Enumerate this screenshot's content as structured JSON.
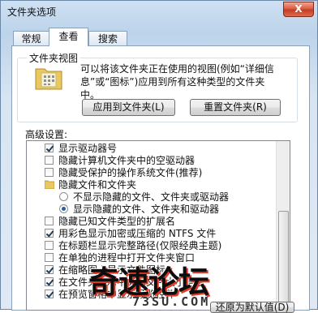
{
  "window": {
    "title": "文件夹选项",
    "close_label": "X"
  },
  "tabs": [
    {
      "label": "常规",
      "active": false
    },
    {
      "label": "查看",
      "active": true
    },
    {
      "label": "搜索",
      "active": false
    }
  ],
  "folder_views": {
    "group_label": "文件夹视图",
    "description_line1": "可以将该文件夹正在使用的视图(例如“详细信",
    "description_line2": "息”或“图标”)应用到所有这种类型的文件夹",
    "description_line3": "中。",
    "apply_button": "应用到文件夹(L)",
    "reset_button": "重置文件夹(R)"
  },
  "advanced": {
    "label": "高级设置:",
    "items": [
      {
        "type": "checkbox",
        "label": "显示驱动器号",
        "checked": true
      },
      {
        "type": "checkbox",
        "label": "隐藏计算机文件夹中的空驱动器",
        "checked": false
      },
      {
        "type": "checkbox",
        "label": "隐藏受保护的操作系统文件(推荐)",
        "checked": false
      },
      {
        "type": "folder",
        "label": "隐藏文件和文件夹"
      },
      {
        "type": "radio",
        "label": "不显示隐藏的文件、文件夹或驱动器",
        "checked": false
      },
      {
        "type": "radio",
        "label": "显示隐藏的文件、文件夹和驱动器",
        "checked": true
      },
      {
        "type": "checkbox",
        "label": "隐藏已知文件类型的扩展名",
        "checked": false
      },
      {
        "type": "checkbox",
        "label": "用彩色显示加密或压缩的 NTFS 文件",
        "checked": true
      },
      {
        "type": "checkbox",
        "label": "在标题栏显示完整路径(仅限经典主题)",
        "checked": false
      },
      {
        "type": "checkbox",
        "label": "在单独的进程中打开文件夹窗口",
        "checked": false
      },
      {
        "type": "checkbox",
        "label": "在缩略图上显示文件图标",
        "checked": true
      },
      {
        "type": "checkbox",
        "label": "在文件夹提示中显示文件大小信息",
        "checked": true
      },
      {
        "type": "checkbox",
        "label": "在预览窗格中显示预览控件",
        "checked": true
      }
    ]
  },
  "restore_button": "还原为默认值(D)",
  "watermark": {
    "main": "奇速论坛",
    "sub": "73SU.COM"
  }
}
